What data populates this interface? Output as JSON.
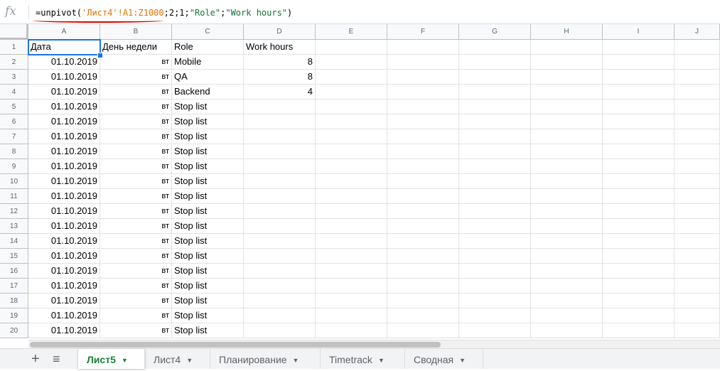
{
  "formula_bar": {
    "fx_icon": "fx-icon",
    "formula_prefix": "=unpivot(",
    "formula_ref": "'Лист4'!A1:Z1000",
    "formula_mid": ";2;1;",
    "formula_str1": "\"Role\"",
    "formula_sep": ";",
    "formula_str2": "\"Work hours\"",
    "formula_suffix": ")"
  },
  "columns": [
    "A",
    "B",
    "C",
    "D",
    "E",
    "F",
    "G",
    "H",
    "I",
    "J"
  ],
  "rows": [
    {
      "n": "1",
      "a": "Дата",
      "b": "День недели",
      "c": "Role",
      "d": "Work hours"
    },
    {
      "n": "2",
      "a": "01.10.2019",
      "b": "вт",
      "c": "Mobile",
      "d": "8"
    },
    {
      "n": "3",
      "a": "01.10.2019",
      "b": "вт",
      "c": "QA",
      "d": "8"
    },
    {
      "n": "4",
      "a": "01.10.2019",
      "b": "вт",
      "c": "Backend",
      "d": "4"
    },
    {
      "n": "5",
      "a": "01.10.2019",
      "b": "вт",
      "c": "Stop list",
      "d": ""
    },
    {
      "n": "6",
      "a": "01.10.2019",
      "b": "вт",
      "c": "Stop list",
      "d": ""
    },
    {
      "n": "7",
      "a": "01.10.2019",
      "b": "вт",
      "c": "Stop list",
      "d": ""
    },
    {
      "n": "8",
      "a": "01.10.2019",
      "b": "вт",
      "c": "Stop list",
      "d": ""
    },
    {
      "n": "9",
      "a": "01.10.2019",
      "b": "вт",
      "c": "Stop list",
      "d": ""
    },
    {
      "n": "10",
      "a": "01.10.2019",
      "b": "вт",
      "c": "Stop list",
      "d": ""
    },
    {
      "n": "11",
      "a": "01.10.2019",
      "b": "вт",
      "c": "Stop list",
      "d": ""
    },
    {
      "n": "12",
      "a": "01.10.2019",
      "b": "вт",
      "c": "Stop list",
      "d": ""
    },
    {
      "n": "13",
      "a": "01.10.2019",
      "b": "вт",
      "c": "Stop list",
      "d": ""
    },
    {
      "n": "14",
      "a": "01.10.2019",
      "b": "вт",
      "c": "Stop list",
      "d": ""
    },
    {
      "n": "15",
      "a": "01.10.2019",
      "b": "вт",
      "c": "Stop list",
      "d": ""
    },
    {
      "n": "16",
      "a": "01.10.2019",
      "b": "вт",
      "c": "Stop list",
      "d": ""
    },
    {
      "n": "17",
      "a": "01.10.2019",
      "b": "вт",
      "c": "Stop list",
      "d": ""
    },
    {
      "n": "18",
      "a": "01.10.2019",
      "b": "вт",
      "c": "Stop list",
      "d": ""
    },
    {
      "n": "19",
      "a": "01.10.2019",
      "b": "вт",
      "c": "Stop list",
      "d": ""
    },
    {
      "n": "20",
      "a": "01.10.2019",
      "b": "вт",
      "c": "Stop list",
      "d": ""
    }
  ],
  "sheet_tabs": [
    {
      "label": "Лист5",
      "active": true
    },
    {
      "label": "Лист4",
      "active": false
    },
    {
      "label": "Планирование",
      "active": false
    },
    {
      "label": "Timetrack",
      "active": false
    },
    {
      "label": "Сводная",
      "active": false
    }
  ],
  "tab_controls": {
    "add": "+",
    "list": "≡"
  },
  "colors": {
    "active_tab": "#188038",
    "selection": "#1a73e8",
    "formula_ref": "#e37400",
    "formula_string": "#137333"
  }
}
